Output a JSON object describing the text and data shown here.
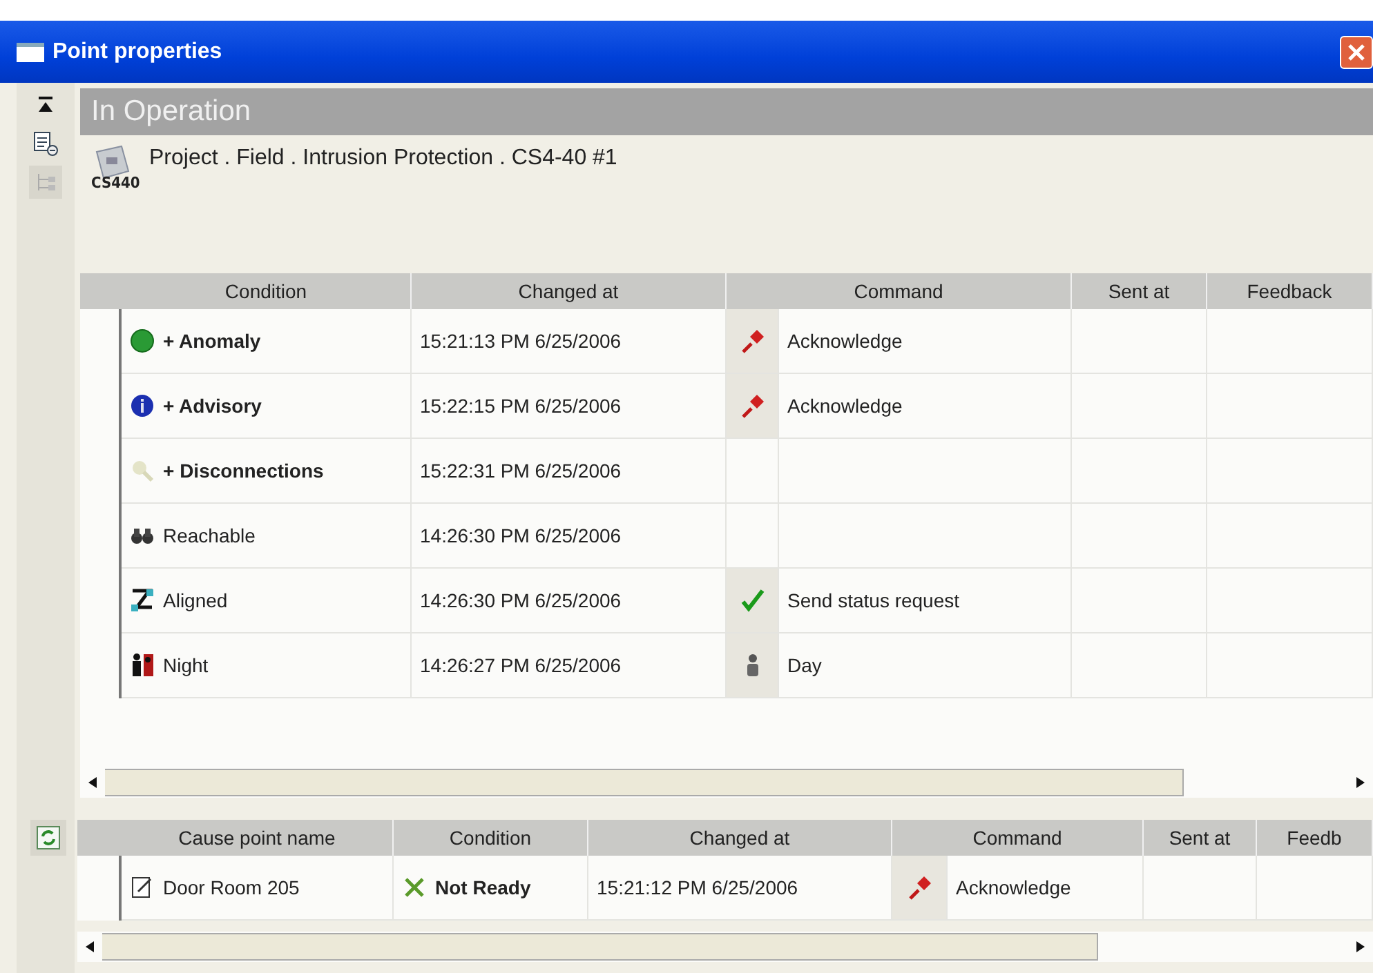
{
  "window": {
    "title": "Point properties"
  },
  "status_header": "In Operation",
  "point": {
    "path": "Project . Field . Intrusion Protection . CS4-40 #1",
    "device_label": "CS440"
  },
  "conditions_table": {
    "columns": [
      "Condition",
      "Changed at",
      "Command",
      "Sent at",
      "Feedback"
    ],
    "rows": [
      {
        "condition": {
          "kind": "anomaly",
          "text": "+ Anomaly",
          "bold": true
        },
        "changed_at": "15:21:13 PM 6/25/2006",
        "command": {
          "kind": "pin",
          "text": "Acknowledge"
        }
      },
      {
        "condition": {
          "kind": "advisory",
          "text": "+ Advisory",
          "bold": true
        },
        "changed_at": "15:22:15 PM 6/25/2006",
        "command": {
          "kind": "pin",
          "text": "Acknowledge"
        }
      },
      {
        "condition": {
          "kind": "disconnection",
          "text": "+ Disconnections",
          "bold": true
        },
        "changed_at": "15:22:31 PM 6/25/2006"
      },
      {
        "condition": {
          "kind": "reachable",
          "text": "Reachable",
          "bold": false
        },
        "changed_at": "14:26:30 PM 6/25/2006"
      },
      {
        "condition": {
          "kind": "aligned",
          "text": "Aligned",
          "bold": false
        },
        "changed_at": "14:26:30 PM 6/25/2006",
        "command": {
          "kind": "check",
          "text": "Send status request"
        }
      },
      {
        "condition": {
          "kind": "night",
          "text": "Night",
          "bold": false
        },
        "changed_at": "14:26:27 PM 6/25/2006",
        "command": {
          "kind": "person",
          "text": "Day"
        }
      }
    ]
  },
  "cause_table": {
    "columns": [
      "Cause point name",
      "Condition",
      "Changed at",
      "Command",
      "Sent at",
      "Feedb"
    ],
    "rows": [
      {
        "name": "Door Room 205",
        "condition": {
          "kind": "not-ready",
          "text": "Not Ready",
          "bold": true
        },
        "changed_at": "15:21:12 PM 6/25/2006",
        "command": {
          "kind": "pin",
          "text": "Acknowledge"
        }
      }
    ]
  }
}
